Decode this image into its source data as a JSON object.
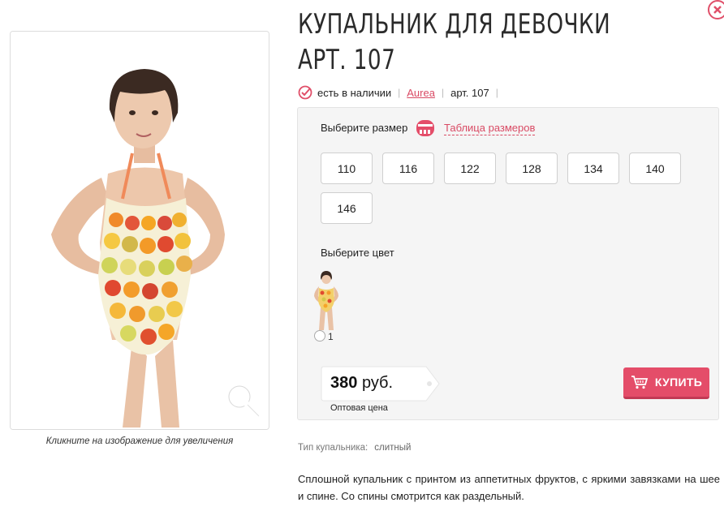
{
  "product": {
    "title": "КУПАЛЬНИК ДЛЯ ДЕВОЧКИ АРТ. 107",
    "availability": "есть в наличии",
    "brand": "Aurea",
    "article": "арт. 107",
    "image_caption": "Кликните на изображение для увеличения"
  },
  "size_section": {
    "label": "Выберите размер",
    "size_table_link": "Таблица размеров",
    "sizes": [
      "110",
      "116",
      "122",
      "128",
      "134",
      "140",
      "146"
    ]
  },
  "color_section": {
    "label": "Выберите цвет",
    "option_number": "1"
  },
  "price": {
    "value": "380",
    "currency": "руб.",
    "note": "Оптовая цена"
  },
  "buy_button": {
    "label": "КУПИТЬ"
  },
  "attributes": {
    "type_label": "Тип купальника:",
    "type_value": "слитный"
  },
  "description": "Сплошной купальник с принтом из аппетитных фруктов, с яркими завязками на шее и спине. Со спины смотрится как раздельный.",
  "colors": {
    "accent": "#e44d69",
    "link": "#d94a64",
    "panel_bg": "#f5f5f5"
  },
  "icons": [
    "check-circle-icon",
    "close-icon",
    "tape-measure-icon",
    "cart-icon",
    "zoom-icon"
  ]
}
